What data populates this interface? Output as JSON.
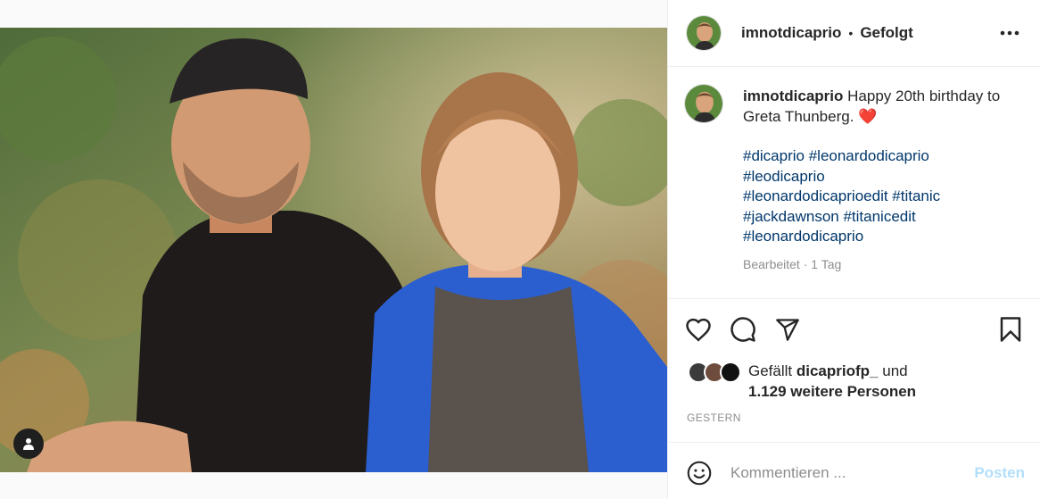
{
  "post": {
    "username": "imnotdicaprio",
    "follow_state": "Gefolgt",
    "header_separator": "•",
    "media_alt": "Leonardo DiCaprio and Greta Thunberg sitting outdoors"
  },
  "caption": {
    "username": "imnotdicaprio",
    "text": "Happy 20th birthday to Greta Thunberg.",
    "emoji": "❤️",
    "hashtags_lines": [
      "#dicaprio #leonardodicaprio",
      "#leodicaprio",
      "#leonardodicaprioedit #titanic",
      "#jackdawnson #titanicedit",
      "#leonardodicaprio"
    ],
    "edited_label": "Bearbeitet",
    "meta_separator": " · ",
    "age": "1 Tag"
  },
  "likes": {
    "prefix": "Gefällt",
    "user": "dicapriofp_",
    "connector": "und",
    "count_text": "1.129 weitere Personen"
  },
  "date_label": "GESTERN",
  "comment": {
    "placeholder": "Kommentieren ...",
    "post_label": "Posten"
  },
  "icons": {
    "more": "more-horizontal-icon",
    "like": "heart-icon",
    "comment": "comment-icon",
    "share": "paper-plane-icon",
    "save": "bookmark-icon",
    "emoji": "smiley-icon",
    "tag": "user-tag-icon"
  },
  "colors": {
    "link": "#00376b",
    "muted": "#8e8e8e",
    "post_button_disabled": "#b2dffc",
    "heart": "#ed2a3a"
  }
}
